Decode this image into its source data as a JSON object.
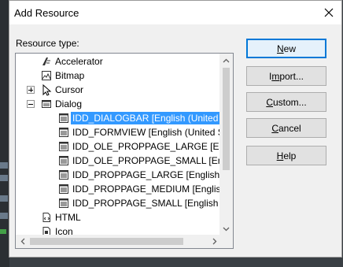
{
  "dialog": {
    "title": "Add Resource",
    "resource_type_label": "Resource type:"
  },
  "tree": {
    "items": [
      {
        "label": "Accelerator",
        "icon": "accelerator-icon",
        "indent": 1,
        "expander": "none"
      },
      {
        "label": "Bitmap",
        "icon": "bitmap-icon",
        "indent": 1,
        "expander": "none"
      },
      {
        "label": "Cursor",
        "icon": "cursor-icon",
        "indent": 1,
        "expander": "plus"
      },
      {
        "label": "Dialog",
        "icon": "dialog-icon",
        "indent": 1,
        "expander": "minus"
      },
      {
        "label": "IDD_DIALOGBAR [English (United States)]",
        "icon": "dialog-template-icon",
        "indent": 2,
        "selected": true
      },
      {
        "label": "IDD_FORMVIEW [English (United States)]",
        "icon": "dialog-template-icon",
        "indent": 2
      },
      {
        "label": "IDD_OLE_PROPPAGE_LARGE [English (United States)]",
        "icon": "dialog-template-icon",
        "indent": 2
      },
      {
        "label": "IDD_OLE_PROPPAGE_SMALL [English (United States)]",
        "icon": "dialog-template-icon",
        "indent": 2
      },
      {
        "label": "IDD_PROPPAGE_LARGE [English (United States)]",
        "icon": "dialog-template-icon",
        "indent": 2
      },
      {
        "label": "IDD_PROPPAGE_MEDIUM [English (United States)]",
        "icon": "dialog-template-icon",
        "indent": 2
      },
      {
        "label": "IDD_PROPPAGE_SMALL [English (United States)]",
        "icon": "dialog-template-icon",
        "indent": 2
      },
      {
        "label": "HTML",
        "icon": "html-icon",
        "indent": 1,
        "expander": "none"
      },
      {
        "label": "Icon",
        "icon": "icon-resource-icon",
        "indent": 1,
        "expander": "none"
      }
    ]
  },
  "buttons": {
    "new": {
      "pre": "",
      "u": "N",
      "post": "ew"
    },
    "import": {
      "pre": "I",
      "u": "m",
      "post": "port..."
    },
    "custom": {
      "pre": "",
      "u": "C",
      "post": "ustom..."
    },
    "cancel": {
      "pre": "",
      "u": "C",
      "post": "ancel"
    },
    "help": {
      "pre": "",
      "u": "H",
      "post": "elp"
    }
  },
  "colors": {
    "selection": "#3399ff",
    "default_button_border": "#0078d7"
  }
}
